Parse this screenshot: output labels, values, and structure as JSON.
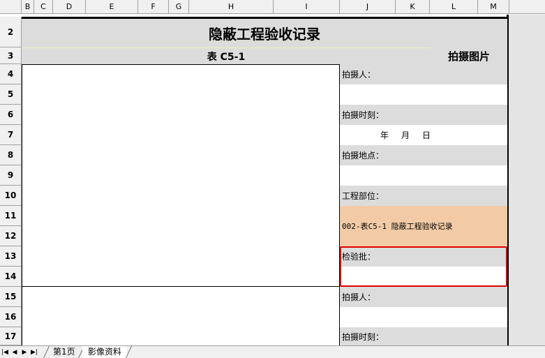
{
  "columns": [
    "B",
    "C",
    "D",
    "E",
    "F",
    "G",
    "H",
    "I",
    "J",
    "K",
    "L",
    "M"
  ],
  "rows": [
    "2",
    "3",
    "4",
    "5",
    "6",
    "7",
    "8",
    "9",
    "10",
    "11",
    "12",
    "13",
    "14",
    "15",
    "16",
    "17"
  ],
  "document": {
    "title": "隐蔽工程验收记录",
    "subtitle": "表 C5-1",
    "photo_label": "拍摄图片"
  },
  "info_fields": {
    "photographer": "拍摄人：",
    "photo_time": "拍摄时刻：",
    "date_year": "年",
    "date_month": "月",
    "date_day": "日",
    "photo_location": "拍摄地点：",
    "project_part": "工程部位：",
    "project_value": "002-表C5-1 隐蔽工程验收记录",
    "inspection_batch": "检验批：",
    "photographer_2": "拍摄人：",
    "photo_time_2": "拍摄时刻："
  },
  "tabs": {
    "items": [
      "第1页",
      "影像资料"
    ],
    "active": "影像资料"
  },
  "nav": {
    "first": "|◀",
    "prev": "◀",
    "next": "▶",
    "last": "▶|"
  }
}
